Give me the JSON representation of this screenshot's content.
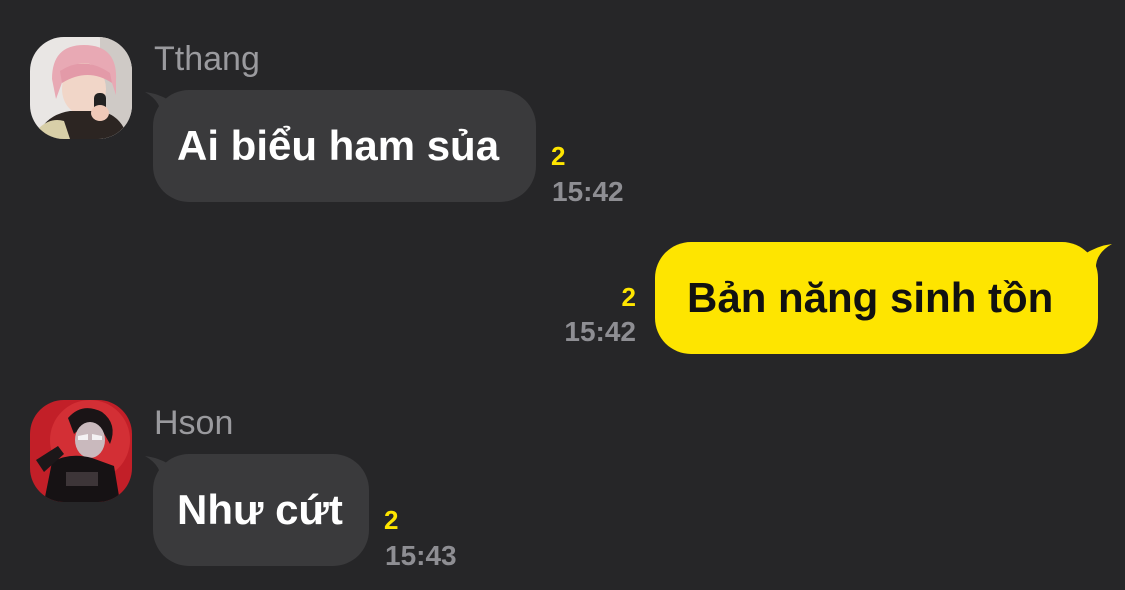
{
  "messages": [
    {
      "sender": "Tthang",
      "direction": "incoming",
      "text": "Ai biểu ham sủa",
      "unread": "2",
      "time": "15:42",
      "avatar_icon": "profile-photo-pink-hair-phone"
    },
    {
      "direction": "outgoing",
      "text": "Bản năng sinh tồn",
      "unread": "2",
      "time": "15:42"
    },
    {
      "sender": "Hson",
      "direction": "incoming",
      "text": "Như cứt",
      "unread": "2",
      "time": "15:43",
      "avatar_icon": "profile-photo-red-background"
    }
  ],
  "colors": {
    "background": "#262628",
    "incoming_bubble": "#3a3a3c",
    "outgoing_bubble": "#fee500",
    "unread_count": "#fee500",
    "timestamp": "#8e8e93",
    "sender_name": "#9a9a9e"
  }
}
